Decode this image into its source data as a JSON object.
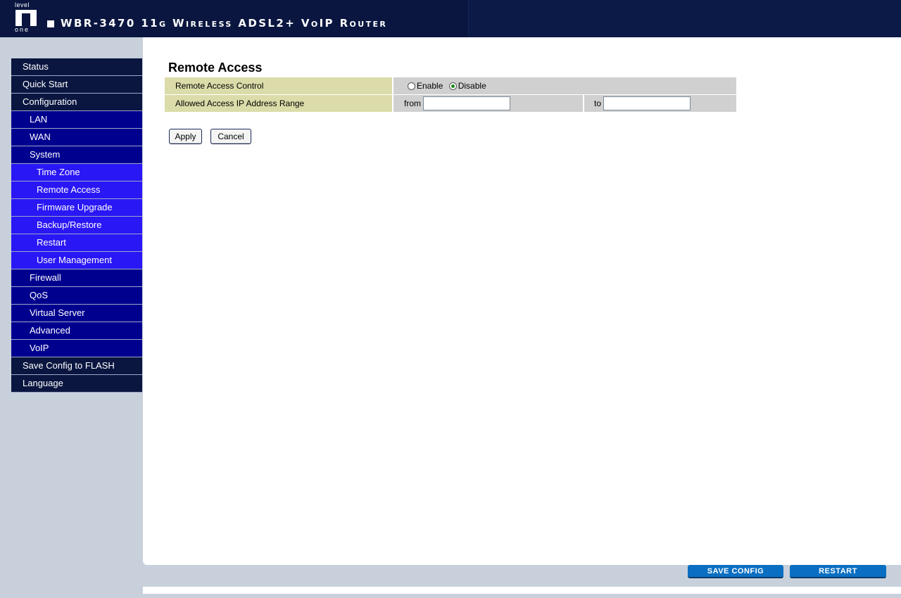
{
  "header": {
    "logo_top": "level",
    "logo_bottom": "one",
    "product_title": "WBR-3470 11g Wireless ADSL2+ VoIP Router"
  },
  "sidebar": {
    "items": [
      {
        "label": "Status",
        "level": 1
      },
      {
        "label": "Quick Start",
        "level": 1
      },
      {
        "label": "Configuration",
        "level": 1
      },
      {
        "label": "LAN",
        "level": 2
      },
      {
        "label": "WAN",
        "level": 2
      },
      {
        "label": "System",
        "level": 2
      },
      {
        "label": "Time Zone",
        "level": 3
      },
      {
        "label": "Remote Access",
        "level": 3
      },
      {
        "label": "Firmware Upgrade",
        "level": 3
      },
      {
        "label": "Backup/Restore",
        "level": 3
      },
      {
        "label": "Restart",
        "level": 3
      },
      {
        "label": "User Management",
        "level": 3
      },
      {
        "label": "Firewall",
        "level": 2
      },
      {
        "label": "QoS",
        "level": 2
      },
      {
        "label": "Virtual Server",
        "level": 2
      },
      {
        "label": "Advanced",
        "level": 2
      },
      {
        "label": "VoIP",
        "level": 2
      },
      {
        "label": "Save Config to FLASH",
        "level": 1
      },
      {
        "label": "Language",
        "level": 1
      }
    ]
  },
  "main": {
    "title": "Remote Access",
    "rows": {
      "control": {
        "label": "Remote Access Control",
        "enable_label": "Enable",
        "disable_label": "Disable",
        "selected": "Disable"
      },
      "range": {
        "label": "Allowed Access IP Address Range",
        "from_label": "from",
        "from_value": "",
        "to_label": "to",
        "to_value": ""
      }
    },
    "apply_label": "Apply",
    "cancel_label": "Cancel"
  },
  "footer": {
    "save_config_label": "SAVE CONFIG",
    "restart_label": "RESTART"
  },
  "colors": {
    "header_bg": "#0a1640",
    "nav_level1": "#0a1640",
    "nav_level2": "#00008f",
    "nav_level3": "#2a17f5",
    "label_cell": "#dcdcaa",
    "value_cell": "#d0d0d0",
    "footer_button": "#0a6fc2"
  }
}
